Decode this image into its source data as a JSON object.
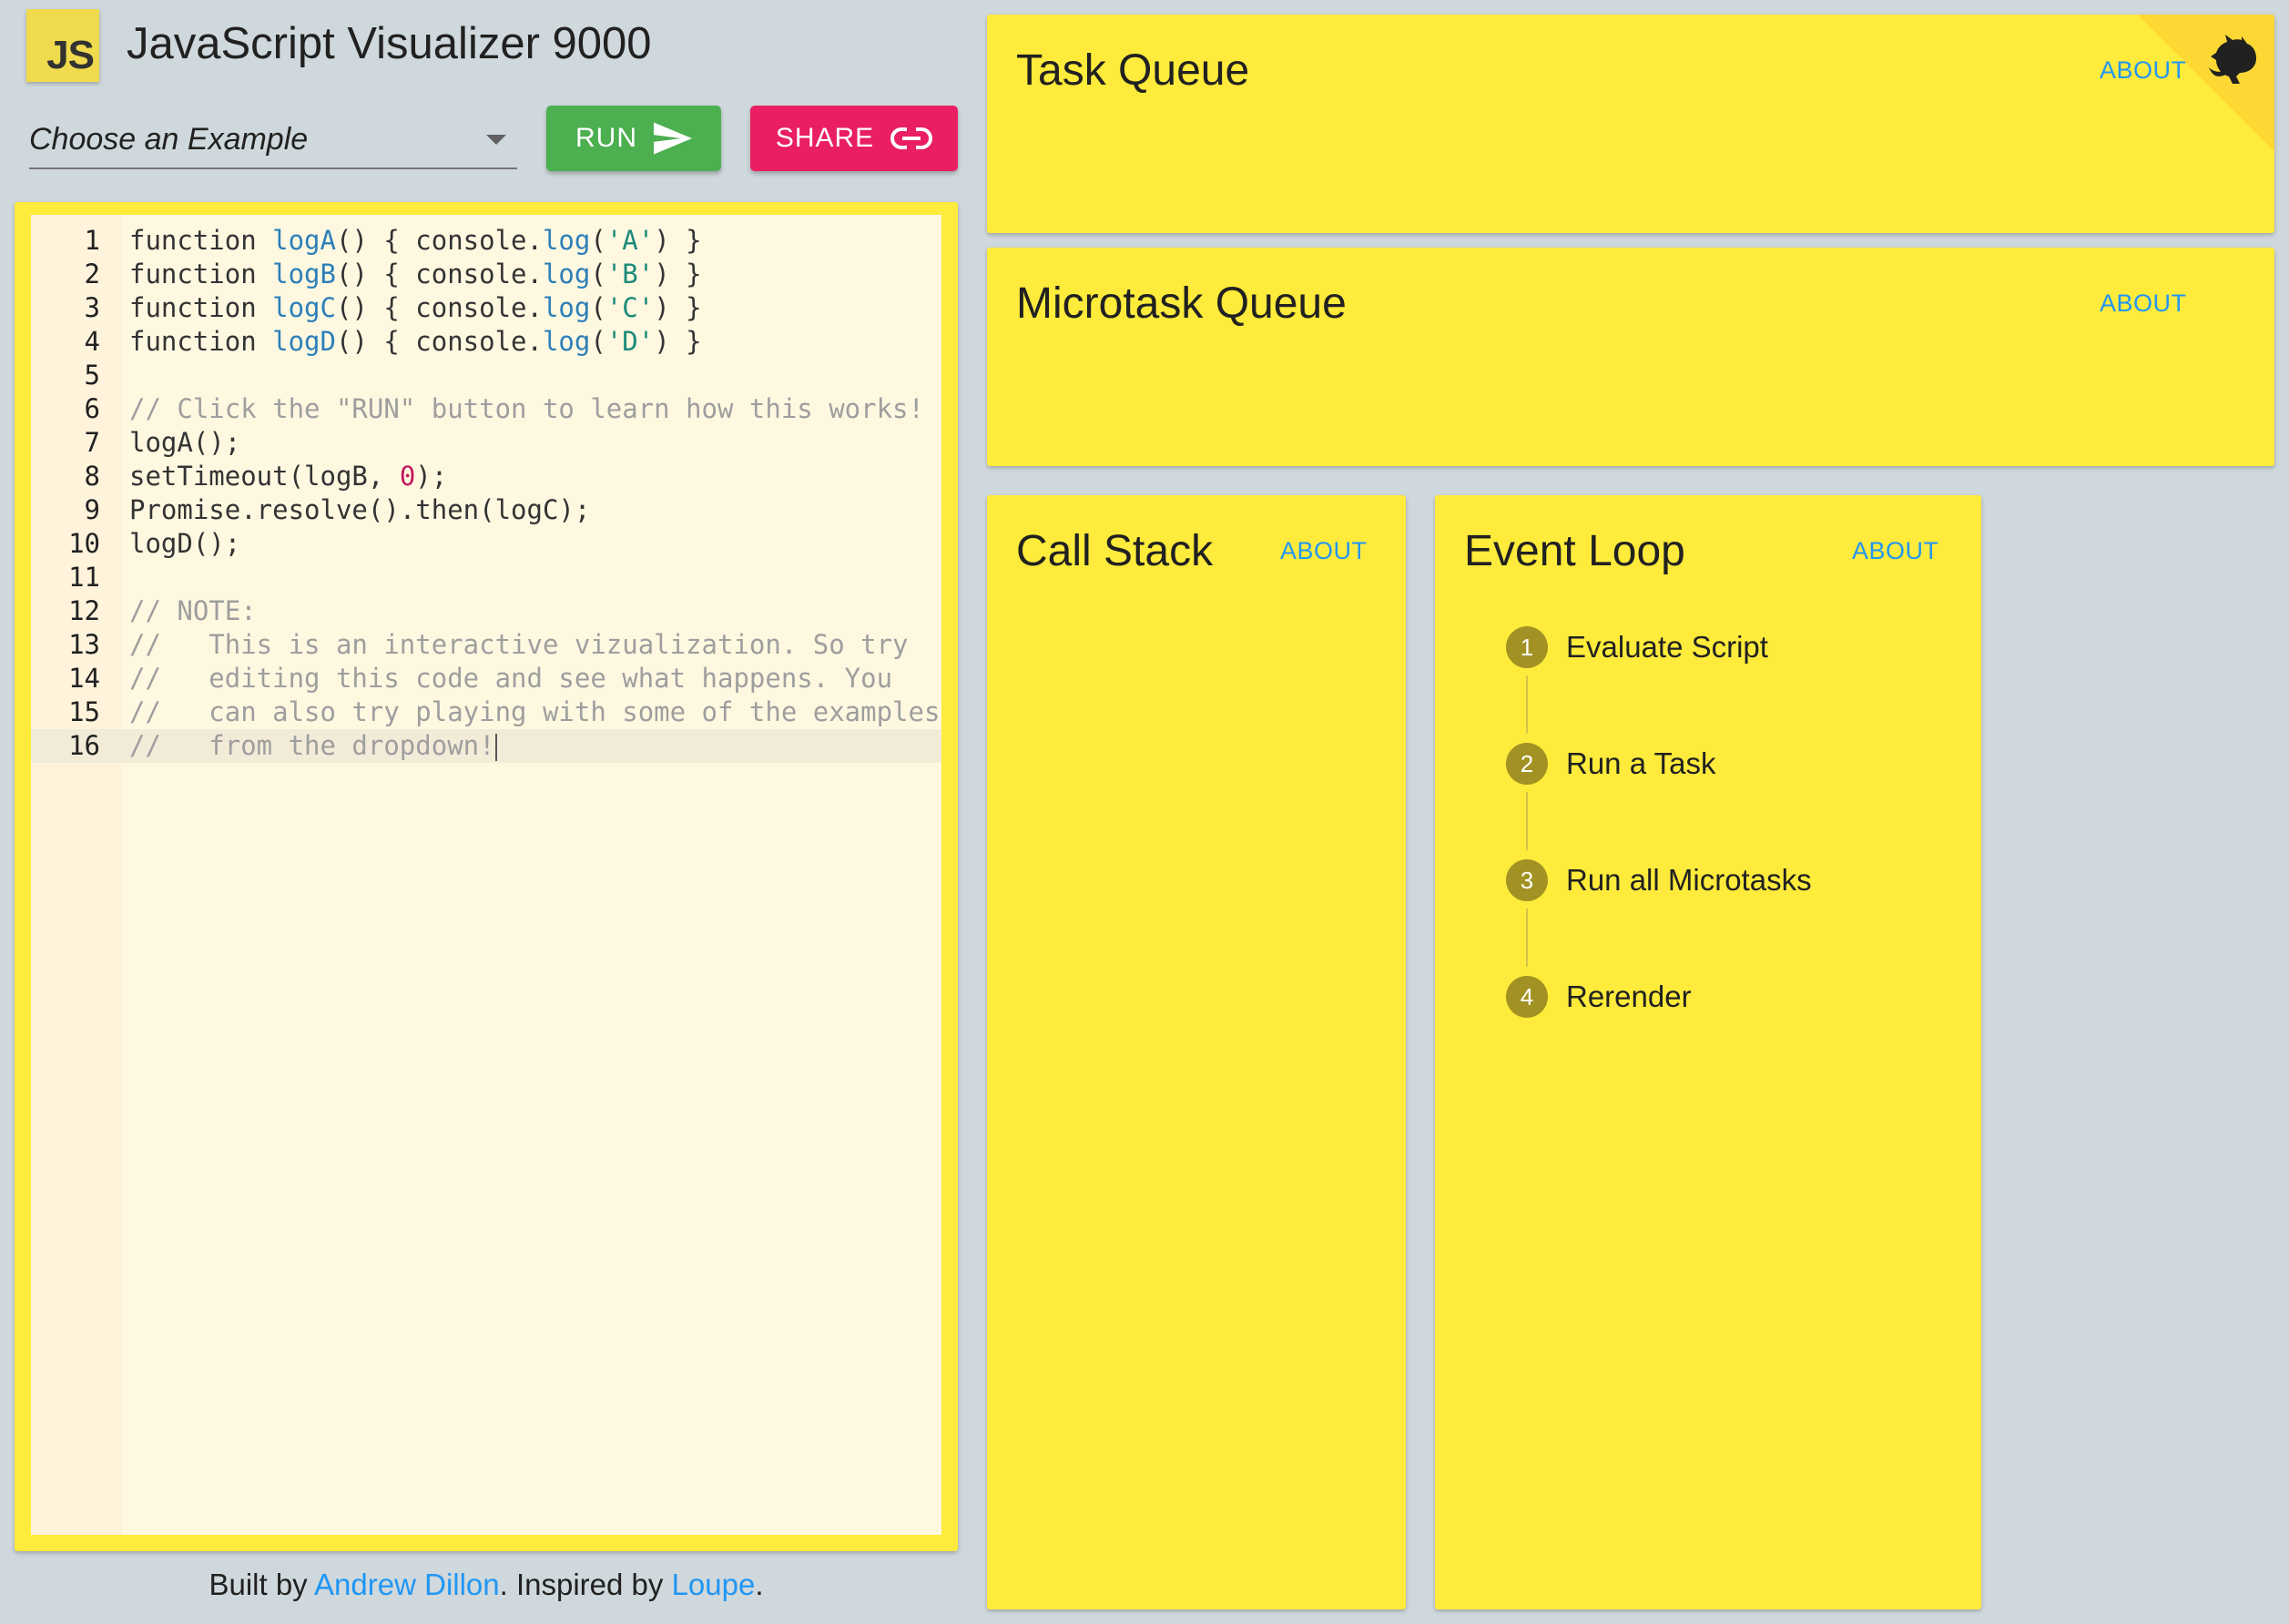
{
  "header": {
    "logo_text": "JS",
    "title": "JavaScript Visualizer 9000"
  },
  "controls": {
    "example_select": "Choose an Example",
    "run_label": "RUN",
    "share_label": "SHARE",
    "run_color": "#4caf50",
    "share_color": "#e91e63"
  },
  "editor": {
    "line_numbers": [
      "1",
      "2",
      "3",
      "4",
      "5",
      "6",
      "7",
      "8",
      "9",
      "10",
      "11",
      "12",
      "13",
      "14",
      "15",
      "16"
    ],
    "lines": [
      [
        [
          "plain",
          "function "
        ],
        [
          "fn",
          "logA"
        ],
        [
          "plain",
          "() { console."
        ],
        [
          "fn",
          "log"
        ],
        [
          "plain",
          "("
        ],
        [
          "str",
          "'A'"
        ],
        [
          "plain",
          ") }"
        ]
      ],
      [
        [
          "plain",
          "function "
        ],
        [
          "fn",
          "logB"
        ],
        [
          "plain",
          "() { console."
        ],
        [
          "fn",
          "log"
        ],
        [
          "plain",
          "("
        ],
        [
          "str",
          "'B'"
        ],
        [
          "plain",
          ") }"
        ]
      ],
      [
        [
          "plain",
          "function "
        ],
        [
          "fn",
          "logC"
        ],
        [
          "plain",
          "() { console."
        ],
        [
          "fn",
          "log"
        ],
        [
          "plain",
          "("
        ],
        [
          "str",
          "'C'"
        ],
        [
          "plain",
          ") }"
        ]
      ],
      [
        [
          "plain",
          "function "
        ],
        [
          "fn",
          "logD"
        ],
        [
          "plain",
          "() { console."
        ],
        [
          "fn",
          "log"
        ],
        [
          "plain",
          "("
        ],
        [
          "str",
          "'D'"
        ],
        [
          "plain",
          ") }"
        ]
      ],
      [],
      [
        [
          "com",
          "// Click the \"RUN\" button to learn how this works!"
        ]
      ],
      [
        [
          "plain",
          "logA();"
        ]
      ],
      [
        [
          "plain",
          "setTimeout(logB, "
        ],
        [
          "num",
          "0"
        ],
        [
          "plain",
          ");"
        ]
      ],
      [
        [
          "plain",
          "Promise.resolve().then(logC);"
        ]
      ],
      [
        [
          "plain",
          "logD();"
        ]
      ],
      [],
      [
        [
          "com",
          "// NOTE:"
        ]
      ],
      [
        [
          "com",
          "//   This is an interactive vizualization. So try"
        ]
      ],
      [
        [
          "com",
          "//   editing this code and see what happens. You"
        ]
      ],
      [
        [
          "com",
          "//   can also try playing with some of the examples"
        ]
      ],
      [
        [
          "com",
          "//   from the dropdown!"
        ]
      ]
    ],
    "active_line": 16
  },
  "footer": {
    "built_by": "Built by ",
    "author": "Andrew Dillon",
    "inspired_by": ". Inspired by ",
    "inspiration": "Loupe",
    "end": "."
  },
  "panels": {
    "task_queue": {
      "title": "Task Queue",
      "about": "ABOUT"
    },
    "microtask_queue": {
      "title": "Microtask Queue",
      "about": "ABOUT"
    },
    "call_stack": {
      "title": "Call Stack",
      "about": "ABOUT"
    },
    "event_loop": {
      "title": "Event Loop",
      "about": "ABOUT",
      "steps": [
        {
          "num": "1",
          "label": "Evaluate Script"
        },
        {
          "num": "2",
          "label": "Run a Task"
        },
        {
          "num": "3",
          "label": "Run all Microtasks"
        },
        {
          "num": "4",
          "label": "Rerender"
        }
      ]
    }
  },
  "icons": {
    "run": "send-icon",
    "share": "link-icon",
    "select": "chevron-down-icon",
    "corner": "github-icon"
  },
  "colors": {
    "panel": "#ffeb3b",
    "background": "#cfd8dc",
    "link": "#2196f3",
    "step_badge": "#a19223"
  }
}
